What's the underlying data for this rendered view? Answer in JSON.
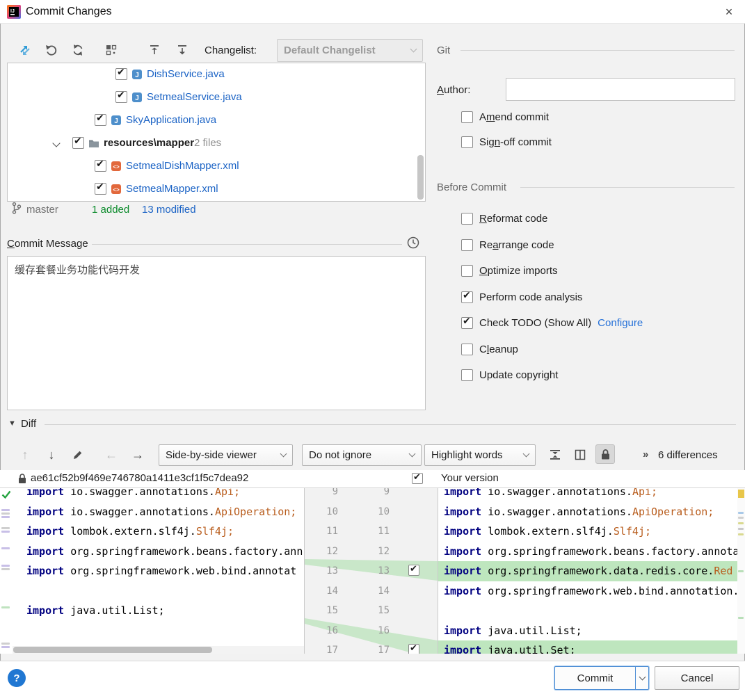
{
  "window": {
    "title": "Commit Changes",
    "close_glyph": "×"
  },
  "toolbar": {
    "changelist_label": "Changelist:",
    "changelist_value": "Default Changelist"
  },
  "file_tree": {
    "items": [
      {
        "name": "DishService.java",
        "type": "java",
        "checked": true
      },
      {
        "name": "SetmealService.java",
        "type": "java",
        "checked": true
      },
      {
        "name": "SkyApplication.java",
        "type": "java",
        "checked": true
      },
      {
        "name": "resources\\mapper",
        "type": "folder",
        "badge": "2 files",
        "checked": true,
        "expanded": true
      },
      {
        "name": "SetmealDishMapper.xml",
        "type": "xml",
        "checked": true
      },
      {
        "name": "SetmealMapper.xml",
        "type": "xml",
        "checked": true
      }
    ]
  },
  "status_bar": {
    "branch": "master",
    "added": "1 added",
    "modified": "13 modified"
  },
  "commit_message": {
    "label": "Commit Message",
    "mnemonic": "C",
    "text": "缓存套餐业务功能代码开发"
  },
  "git_panel": {
    "section": "Git",
    "author_label": "Author:",
    "author_mnemonic": "A",
    "author_value": "",
    "amend_label": "Amend commit",
    "amend_mnemonic": "m",
    "amend_checked": false,
    "signoff_label": "Sign-off commit",
    "signoff_mnemonic": "n",
    "signoff_checked": false
  },
  "before_commit": {
    "section": "Before Commit",
    "options": [
      {
        "label": "Reformat code",
        "mnemonic": "R",
        "checked": false
      },
      {
        "label": "Rearrange code",
        "mnemonic": "a",
        "checked": false
      },
      {
        "label": "Optimize imports",
        "mnemonic": "O",
        "checked": false
      },
      {
        "label": "Perform code analysis",
        "checked": true
      },
      {
        "label": "Check TODO (Show All)",
        "checked": true,
        "link": "Configure"
      },
      {
        "label": "Cleanup",
        "mnemonic": "l",
        "checked": false
      },
      {
        "label": "Update copyright",
        "checked": false
      }
    ]
  },
  "diff": {
    "section": "Diff",
    "viewer_mode": "Side-by-side viewer",
    "ignore_mode": "Do not ignore",
    "highlight_mode": "Highlight words",
    "chevrons": "»",
    "differences": "6 differences",
    "left_revision": "ae61cf52b9f469e746780a1411e3cf1f5c7dea92",
    "right_title": "Your version",
    "right_title_checked": true,
    "gutter": [
      {
        "l": "9",
        "r": "9"
      },
      {
        "l": "10",
        "r": "10"
      },
      {
        "l": "11",
        "r": "11"
      },
      {
        "l": "12",
        "r": "12"
      },
      {
        "l": "13",
        "r": "13",
        "checked": true
      },
      {
        "l": "14",
        "r": "14"
      },
      {
        "l": "15",
        "r": "15"
      },
      {
        "l": "16",
        "r": "16"
      },
      {
        "l": "17",
        "r": "17",
        "checked": true
      }
    ],
    "left_lines": [
      {
        "t": [
          [
            "kw",
            "import "
          ],
          [
            "pl",
            "io.swagger.annotations."
          ],
          [
            "cl",
            "Api;"
          ]
        ]
      },
      {
        "t": [
          [
            "kw",
            "import "
          ],
          [
            "pl",
            "io.swagger.annotations."
          ],
          [
            "cl",
            "ApiOperation;"
          ]
        ]
      },
      {
        "t": [
          [
            "kw",
            "import "
          ],
          [
            "pl",
            "lombok.extern.slf4j."
          ],
          [
            "cl",
            "Slf4j;"
          ]
        ]
      },
      {
        "t": [
          [
            "kw",
            "import "
          ],
          [
            "pl",
            "org.springframework.beans.factory.ann"
          ]
        ]
      },
      {
        "t": [
          [
            "kw",
            "import "
          ],
          [
            "pl",
            "org.springframework.web.bind.annotat"
          ]
        ]
      },
      {
        "t": []
      },
      {
        "t": [
          [
            "kw",
            "import "
          ],
          [
            "pl",
            "java.util.List;"
          ]
        ]
      },
      {
        "t": []
      },
      {
        "t": [
          [
            "pl",
            "/**"
          ]
        ]
      }
    ],
    "right_lines": [
      {
        "t": [
          [
            "kw",
            "import "
          ],
          [
            "pl",
            "io.swagger.annotations."
          ],
          [
            "cl",
            "Api;"
          ]
        ]
      },
      {
        "t": [
          [
            "kw",
            "import "
          ],
          [
            "pl",
            "io.swagger.annotations."
          ],
          [
            "cl",
            "ApiOperation;"
          ]
        ]
      },
      {
        "t": [
          [
            "kw",
            "import "
          ],
          [
            "pl",
            "lombok.extern.slf4j."
          ],
          [
            "cl",
            "Slf4j;"
          ]
        ]
      },
      {
        "t": [
          [
            "kw",
            "import "
          ],
          [
            "pl",
            "org.springframework.beans.factory.annota"
          ]
        ]
      },
      {
        "added": true,
        "t": [
          [
            "kw",
            "import "
          ],
          [
            "pl",
            "org.springframework.data.redis.core."
          ],
          [
            "cl",
            "Red"
          ]
        ]
      },
      {
        "t": [
          [
            "kw",
            "import "
          ],
          [
            "pl",
            "org.springframework.web.bind.annotation."
          ]
        ]
      },
      {
        "t": []
      },
      {
        "t": [
          [
            "kw",
            "import "
          ],
          [
            "pl",
            "java.util.List;"
          ]
        ]
      },
      {
        "added": true,
        "t": [
          [
            "kw",
            "import "
          ],
          [
            "pl",
            "java.util.Set;"
          ]
        ]
      }
    ]
  },
  "footer": {
    "help": "?",
    "commit": "Commit",
    "cancel": "Cancel"
  },
  "colors": {
    "added_line_bg": "#BEE6BE",
    "added_text": "#0a8a2a",
    "modified_file": "#1b63c5",
    "link": "#2470d8",
    "keyword": "#000080",
    "class_ref": "#b85c1c",
    "help_button": "#2077d2"
  }
}
